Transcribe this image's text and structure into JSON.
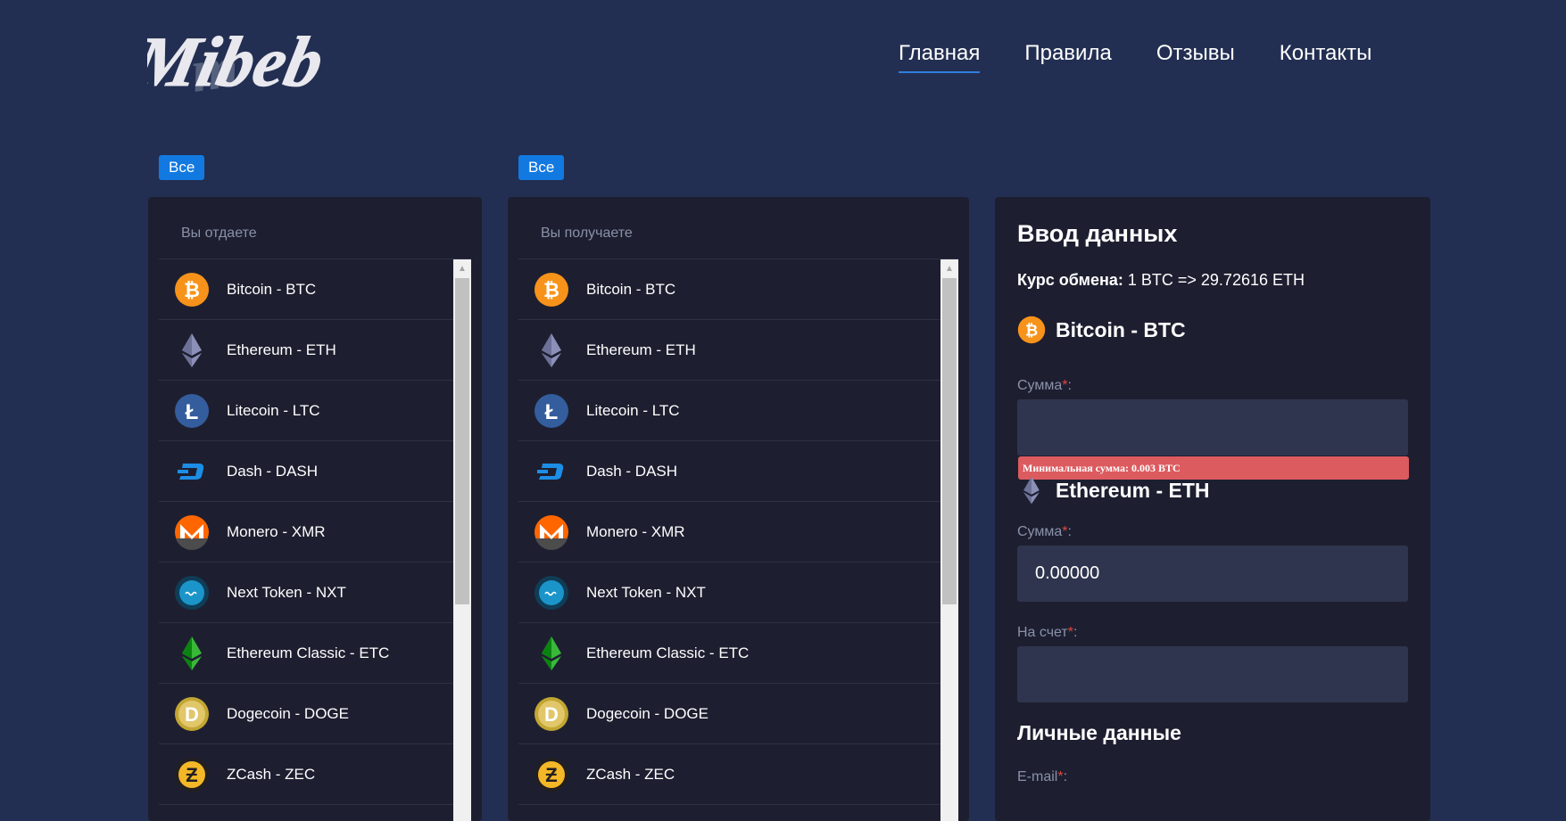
{
  "header": {
    "logo_text": "Mibeb",
    "nav": [
      {
        "label": "Главная",
        "active": true
      },
      {
        "label": "Правила",
        "active": false
      },
      {
        "label": "Отзывы",
        "active": false
      },
      {
        "label": "Контакты",
        "active": false
      }
    ]
  },
  "give_panel": {
    "filter_label": "Все",
    "title": "Вы отдаете",
    "items": [
      {
        "label": "Bitcoin - BTC",
        "icon": "bitcoin-icon"
      },
      {
        "label": "Ethereum - ETH",
        "icon": "ethereum-icon"
      },
      {
        "label": "Litecoin - LTC",
        "icon": "litecoin-icon"
      },
      {
        "label": "Dash - DASH",
        "icon": "dash-icon"
      },
      {
        "label": "Monero - XMR",
        "icon": "monero-icon"
      },
      {
        "label": "Next Token - NXT",
        "icon": "nxt-icon"
      },
      {
        "label": "Ethereum Classic - ETC",
        "icon": "ethereum-classic-icon"
      },
      {
        "label": "Dogecoin - DOGE",
        "icon": "dogecoin-icon"
      },
      {
        "label": "ZCash - ZEC",
        "icon": "zcash-icon"
      }
    ]
  },
  "get_panel": {
    "filter_label": "Все",
    "title": "Вы получаете",
    "items": [
      {
        "label": "Bitcoin - BTC",
        "icon": "bitcoin-icon"
      },
      {
        "label": "Ethereum - ETH",
        "icon": "ethereum-icon"
      },
      {
        "label": "Litecoin - LTC",
        "icon": "litecoin-icon"
      },
      {
        "label": "Dash - DASH",
        "icon": "dash-icon"
      },
      {
        "label": "Monero - XMR",
        "icon": "monero-icon"
      },
      {
        "label": "Next Token - NXT",
        "icon": "nxt-icon"
      },
      {
        "label": "Ethereum Classic - ETC",
        "icon": "ethereum-classic-icon"
      },
      {
        "label": "Dogecoin - DOGE",
        "icon": "dogecoin-icon"
      },
      {
        "label": "ZCash - ZEC",
        "icon": "zcash-icon"
      }
    ]
  },
  "form": {
    "title": "Ввод данных",
    "rate_label": "Курс обмена:",
    "rate_value": "1 BTC => 29.72616 ETH",
    "give_currency": "Bitcoin - BTC",
    "give_amount_label": "Сумма",
    "give_amount_value": "",
    "error_message": "Минимальная сумма: 0.003 BTC",
    "get_currency": "Ethereum - ETH",
    "get_amount_label": "Сумма",
    "get_amount_value": "0.00000",
    "account_label": "На счет",
    "account_value": "",
    "personal_title": "Личные данные",
    "email_label": "E-mail",
    "required_mark": "*",
    "label_suffix": ":"
  },
  "colors": {
    "background": "#232f52",
    "panel": "#1d1f30",
    "accent": "#1279e0",
    "error": "#dc5b5f",
    "input": "#30354f"
  }
}
